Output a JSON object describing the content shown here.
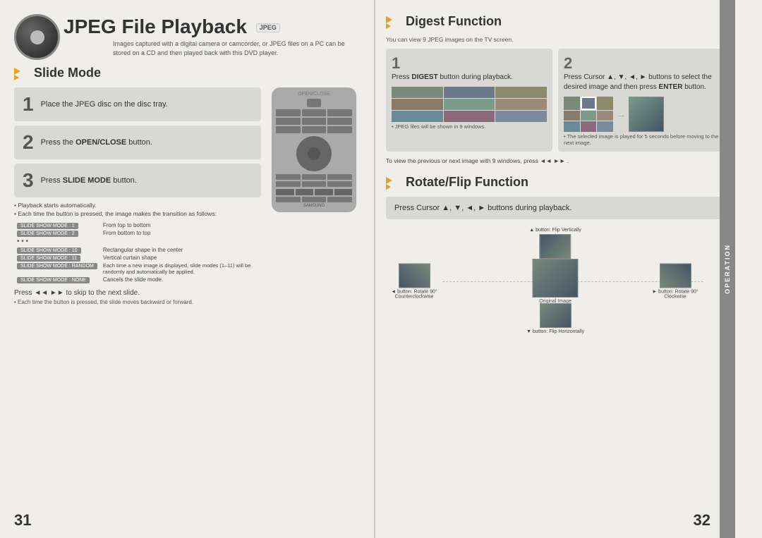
{
  "left_page": {
    "page_number": "31",
    "header": {
      "title": "JPEG File Playback",
      "badge": "JPEG",
      "subtitle": "Images captured with a digital camera or camcorder, or JPEG files on a PC can be stored on a CD and then played back with this DVD player."
    },
    "section_title": "Slide Mode",
    "steps": [
      {
        "number": "1",
        "text": "Place the JPEG disc on the disc tray."
      },
      {
        "number": "2",
        "text_plain": "Press the ",
        "text_bold": "OPEN/CLOSE",
        "text_end": " button."
      },
      {
        "number": "3",
        "text_plain": "Press ",
        "text_bold": "SLIDE MODE",
        "text_end": " button."
      }
    ],
    "bullets": [
      "Playback starts automatically.",
      "Each time the button is pressed, the image makes the transition as follows:"
    ],
    "slide_modes": [
      {
        "mode": "SLIDE SHOW MODE : 1",
        "desc": "From top to bottom"
      },
      {
        "mode": "SLIDE SHOW MODE : 2",
        "desc": "From bottom to top"
      },
      {
        "mode": "...",
        "desc": ""
      },
      {
        "mode": "SLIDE SHOW MODE : 10",
        "desc": "Rectangular shape in the center"
      },
      {
        "mode": "SLIDE SHOW MODE : 11",
        "desc": "Vertical curtain shape"
      },
      {
        "mode": "SLIDE SHOW MODE : RANDOM",
        "desc": "Each time a new image is displayed, slide modes (1–11) will be randomly and automatically be applied."
      },
      {
        "mode": "SLIDE SHOW MODE : NONE",
        "desc": "Cancels the slide mode."
      }
    ],
    "skip_text": "Press",
    "skip_label": "◄◄ ►► ",
    "skip_end": "to skip to the next slide.",
    "skip_note": "Each time the button is pressed, the slide moves backward or forward."
  },
  "right_page": {
    "page_number": "32",
    "operation_label": "OPERATION",
    "digest_section": {
      "title": "Digest Function",
      "subtitle": "You can view 9 JPEG images on the TV screen.",
      "step1_num": "1",
      "step1_text_plain": "Press ",
      "step1_bold": "DIGEST",
      "step1_end": " button during playback.",
      "step2_num": "2",
      "step2_text": "Press Cursor ▲, ▼, ◄, ► buttons to select the desired image and then press ",
      "step2_bold": "ENTER",
      "step2_end": " button.",
      "note1": "JPEG files will be shown in 9 windows.",
      "note2": "The selected image is played for 5 seconds before moving to the next image.",
      "to_view_note": "To view the previous or next image with 9 windows, press ◄◄ ►► ."
    },
    "rotate_section": {
      "title": "Rotate/Flip Function",
      "step_text": "Press Cursor ▲, ▼, ◄, ► buttons during playback.",
      "original_label": "Original Image",
      "up_label": "▲ button: Flip Vertically",
      "left_label": "◄ button: Rotate 90° Counterclockwise",
      "right_label": "► button: Rotate 90° Clockwise",
      "down_label": "▼ button: Flip Horizontally"
    }
  }
}
